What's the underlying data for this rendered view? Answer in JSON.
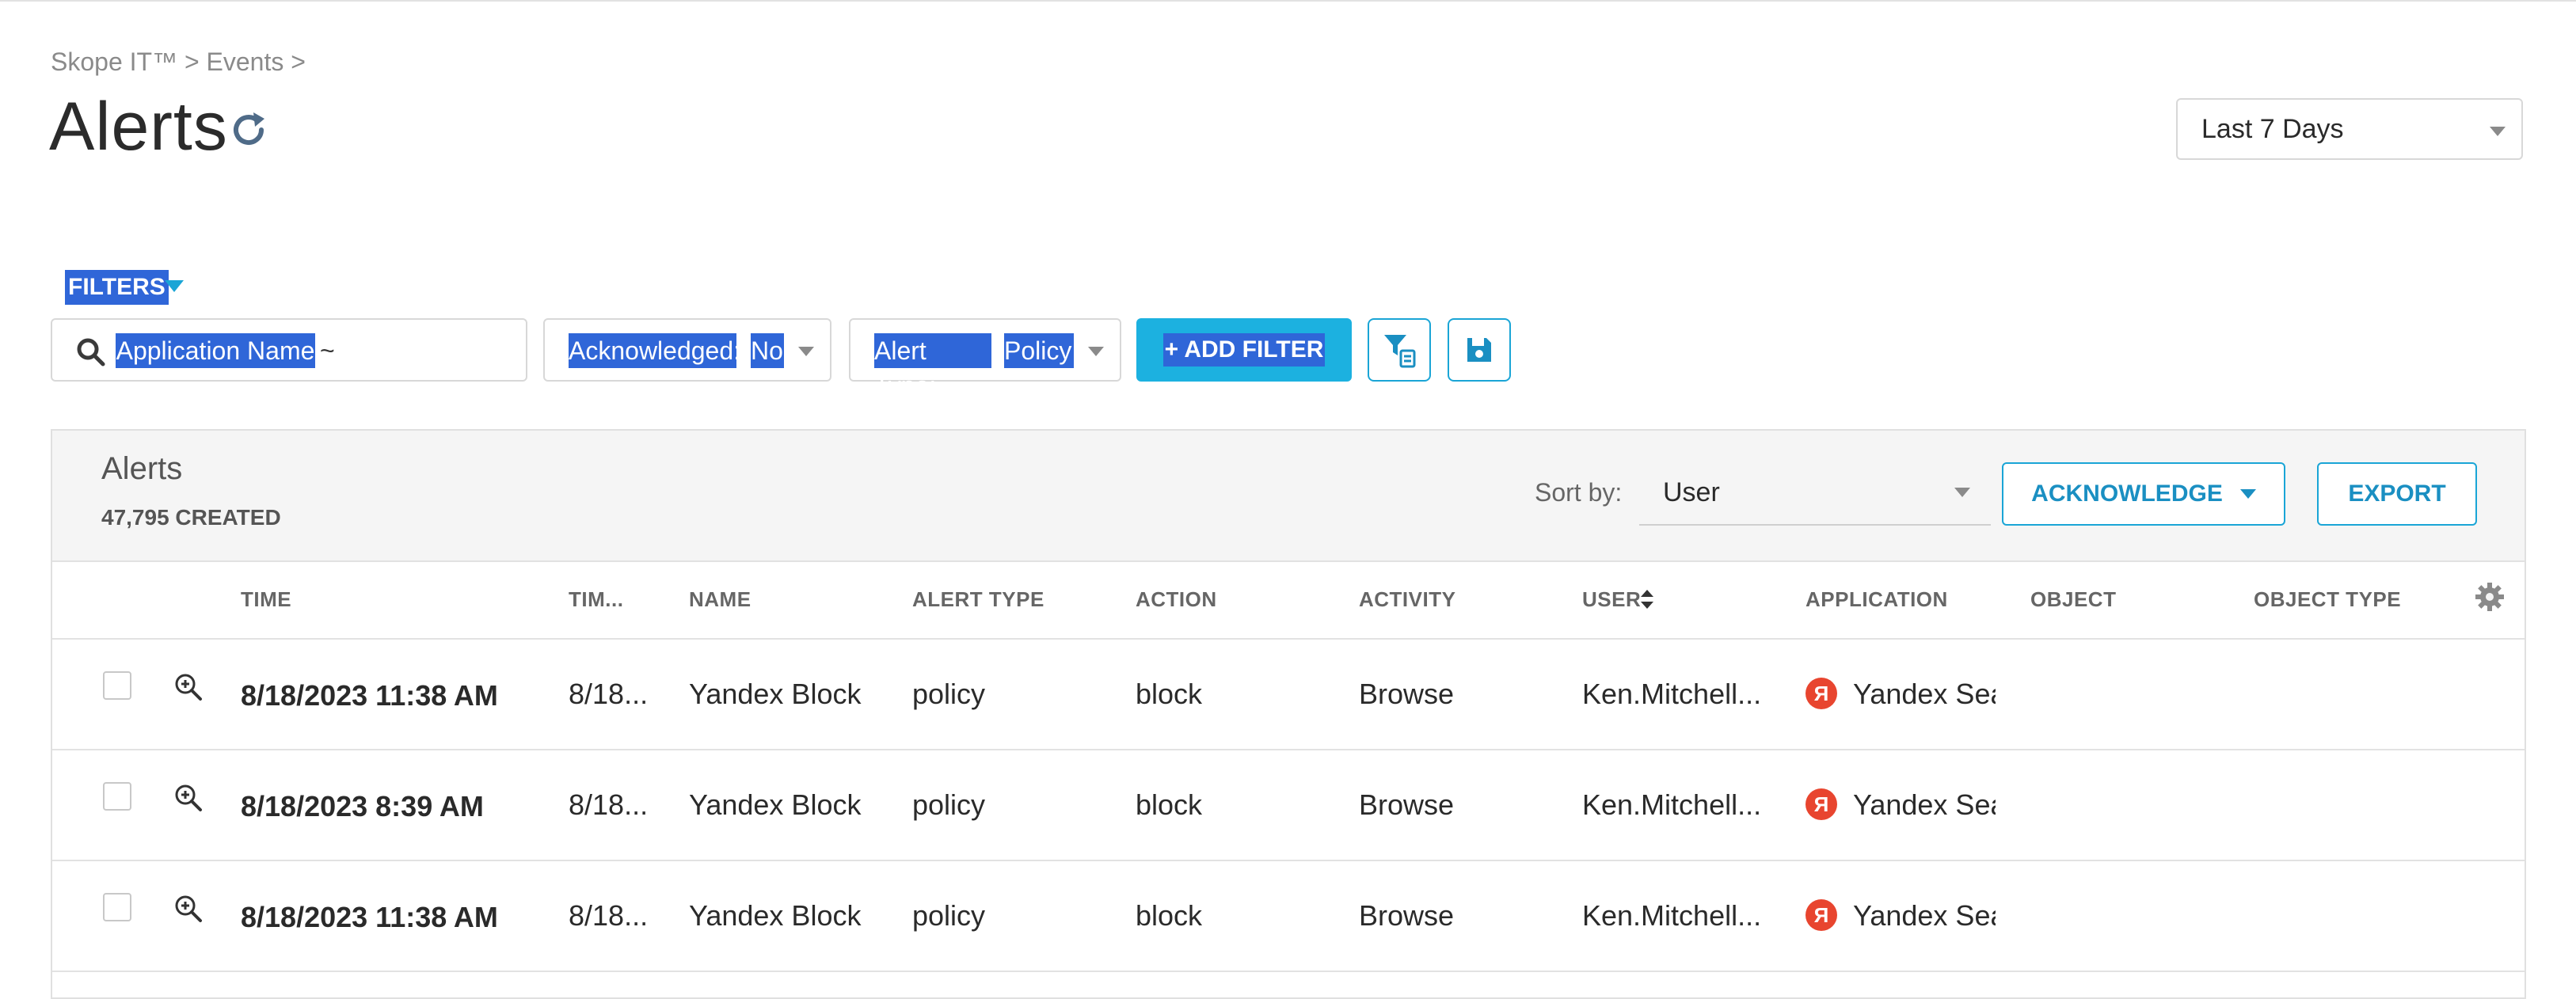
{
  "breadcrumb": "Skope IT™ > Events >",
  "page": {
    "title": "Alerts"
  },
  "range": {
    "selected": "Last 7 Days"
  },
  "filters": {
    "label": "FILTERS",
    "search_text": "Application Name",
    "search_suffix": "~",
    "ack_key": "Acknowledged:",
    "ack_value": "No",
    "type_key": "Alert Type:",
    "type_value": "Policy",
    "add_label": "+ ADD FILTER"
  },
  "panel": {
    "title": "Alerts",
    "count": "47,795 CREATED",
    "sort_label": "Sort by:",
    "sort_value": "User",
    "acknowledge_label": "ACKNOWLEDGE",
    "export_label": "EXPORT"
  },
  "columns": {
    "time": "TIME",
    "tim": "TIM...",
    "name": "NAME",
    "alert_type": "ALERT TYPE",
    "action": "ACTION",
    "activity": "ACTIVITY",
    "user": "USER",
    "application": "APPLICATION",
    "object": "OBJECT",
    "object_type": "OBJECT TYPE"
  },
  "rows": [
    {
      "time": "8/18/2023 11:38 AM",
      "tim": "8/18...",
      "name": "Yandex Block",
      "alert_type": "policy",
      "action": "block",
      "activity": "Browse",
      "user": "Ken.Mitchell...",
      "app_letter": "Я",
      "application": "Yandex Sear"
    },
    {
      "time": "8/18/2023 8:39 AM",
      "tim": "8/18...",
      "name": "Yandex Block",
      "alert_type": "policy",
      "action": "block",
      "activity": "Browse",
      "user": "Ken.Mitchell...",
      "app_letter": "Я",
      "application": "Yandex Sear"
    },
    {
      "time": "8/18/2023 11:38 AM",
      "tim": "8/18...",
      "name": "Yandex Block",
      "alert_type": "policy",
      "action": "block",
      "activity": "Browse",
      "user": "Ken.Mitchell...",
      "app_letter": "Я",
      "application": "Yandex Sear"
    }
  ],
  "colors": {
    "accent": "#1aa5d6",
    "selection": "#2f66d8",
    "yandex": "#e8452f"
  }
}
